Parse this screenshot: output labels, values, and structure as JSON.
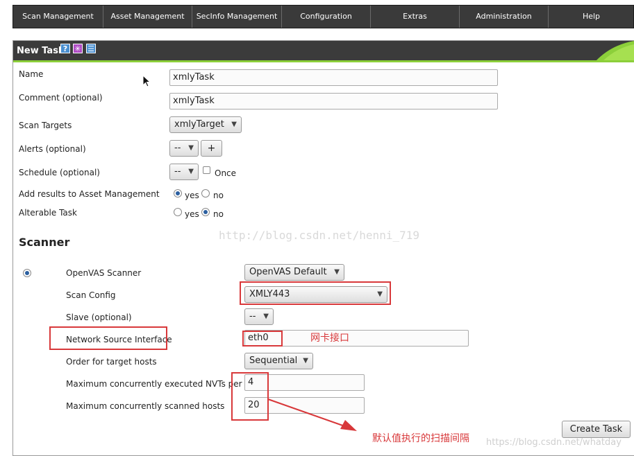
{
  "nav": {
    "items": [
      "Scan Management",
      "Asset Management",
      "SecInfo Management",
      "Configuration",
      "Extras",
      "Administration",
      "Help"
    ]
  },
  "panel": {
    "title": "New Task",
    "icons": [
      "help-icon",
      "wizard-icon",
      "list-icon"
    ]
  },
  "form": {
    "name_label": "Name",
    "name_value": "xmlyTask",
    "comment_label": "Comment (optional)",
    "comment_value": "xmlyTask",
    "targets_label": "Scan Targets",
    "targets_value": "xmlyTarget",
    "alerts_label": "Alerts (optional)",
    "alerts_value": "--",
    "alerts_add": "+",
    "schedule_label": "Schedule (optional)",
    "schedule_value": "--",
    "schedule_once": "Once",
    "add_results_label": "Add results to Asset Management",
    "alterable_label": "Alterable Task",
    "yes": "yes",
    "no": "no",
    "add_results_selected": "yes",
    "alterable_selected": "no"
  },
  "scanner": {
    "heading": "Scanner",
    "scanner_label": "OpenVAS Scanner",
    "scanner_value": "OpenVAS Default",
    "config_label": "Scan Config",
    "config_value": "XMLY443",
    "slave_label": "Slave (optional)",
    "slave_value": "--",
    "iface_label": "Network Source Interface",
    "iface_value": "eth0",
    "order_label": "Order for target hosts",
    "order_value": "Sequential",
    "max_nvts_label": "Maximum concurrently executed NVTs per host",
    "max_nvts_value": "4",
    "max_hosts_label": "Maximum concurrently scanned hosts",
    "max_hosts_value": "20",
    "create_button": "Create Task"
  },
  "annotations": {
    "iface_note": "网卡接口",
    "interval_note": "默认值执行的扫描间隔",
    "watermark_center": "http://blog.csdn.net/henni_719",
    "watermark_corner": "https://blog.csdn.net/whatday"
  },
  "colors": {
    "nav_bg": "#3a3a3a",
    "header_bg": "#3b3b3b",
    "accent_green": "#8ccf3a",
    "annotation_red": "#d8383a",
    "radio_fill": "#2b5fa0"
  }
}
